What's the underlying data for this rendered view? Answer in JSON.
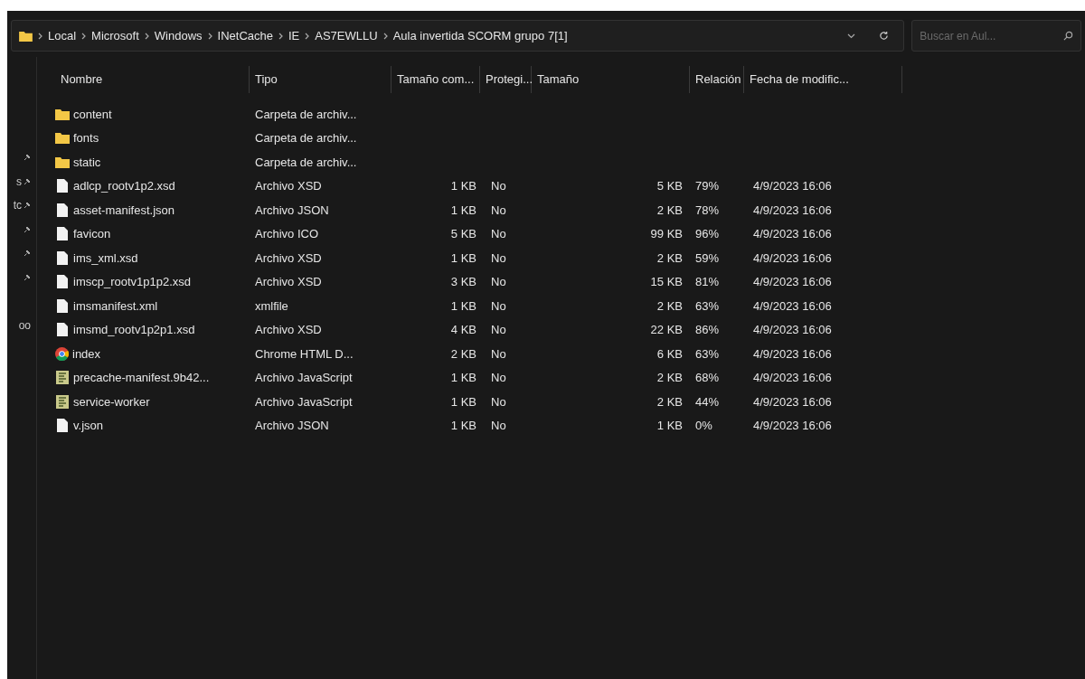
{
  "address_bar": {
    "crumbs": [
      "Local",
      "Microsoft",
      "Windows",
      "INetCache",
      "IE",
      "AS7EWLLU",
      "Aula invertida SCORM grupo 7[1]"
    ]
  },
  "search": {
    "placeholder": "Buscar en Aul..."
  },
  "sidebar": {
    "items": [
      {
        "pinned": false
      },
      {
        "pinned": false
      },
      {
        "pinned": true
      },
      {
        "label": "s",
        "pinned": true
      },
      {
        "label": "tc",
        "pinned": true
      },
      {
        "pinned": true
      },
      {
        "pinned": true
      },
      {
        "pinned": true
      },
      {
        "pinned": false
      },
      {
        "label": "oo",
        "pinned": false
      }
    ]
  },
  "table": {
    "columns": [
      "Nombre",
      "Tipo",
      "Tamaño com...",
      "Protegi...",
      "Tamaño",
      "Relación",
      "Fecha de modific..."
    ],
    "rows": [
      {
        "kind": "folder",
        "name": "content",
        "type": "Carpeta de archiv..."
      },
      {
        "kind": "folder",
        "name": "fonts",
        "type": "Carpeta de archiv..."
      },
      {
        "kind": "folder",
        "name": "static",
        "type": "Carpeta de archiv..."
      },
      {
        "kind": "file",
        "name": "adlcp_rootv1p2.xsd",
        "type": "Archivo XSD",
        "compressed": "1 KB",
        "protected": "No",
        "size": "5 KB",
        "ratio": "79%",
        "date": "4/9/2023 16:06"
      },
      {
        "kind": "file",
        "name": "asset-manifest.json",
        "type": "Archivo JSON",
        "compressed": "1 KB",
        "protected": "No",
        "size": "2 KB",
        "ratio": "78%",
        "date": "4/9/2023 16:06"
      },
      {
        "kind": "file",
        "name": "favicon",
        "type": "Archivo ICO",
        "compressed": "5 KB",
        "protected": "No",
        "size": "99 KB",
        "ratio": "96%",
        "date": "4/9/2023 16:06"
      },
      {
        "kind": "file",
        "name": "ims_xml.xsd",
        "type": "Archivo XSD",
        "compressed": "1 KB",
        "protected": "No",
        "size": "2 KB",
        "ratio": "59%",
        "date": "4/9/2023 16:06"
      },
      {
        "kind": "file",
        "name": "imscp_rootv1p1p2.xsd",
        "type": "Archivo XSD",
        "compressed": "3 KB",
        "protected": "No",
        "size": "15 KB",
        "ratio": "81%",
        "date": "4/9/2023 16:06"
      },
      {
        "kind": "file",
        "name": "imsmanifest.xml",
        "type": "xmlfile",
        "compressed": "1 KB",
        "protected": "No",
        "size": "2 KB",
        "ratio": "63%",
        "date": "4/9/2023 16:06"
      },
      {
        "kind": "file",
        "name": "imsmd_rootv1p2p1.xsd",
        "type": "Archivo XSD",
        "compressed": "4 KB",
        "protected": "No",
        "size": "22 KB",
        "ratio": "86%",
        "date": "4/9/2023 16:06"
      },
      {
        "kind": "chrome",
        "name": "index",
        "type": "Chrome HTML D...",
        "compressed": "2 KB",
        "protected": "No",
        "size": "6 KB",
        "ratio": "63%",
        "date": "4/9/2023 16:06"
      },
      {
        "kind": "script",
        "name": "precache-manifest.9b42...",
        "type": "Archivo JavaScript",
        "compressed": "1 KB",
        "protected": "No",
        "size": "2 KB",
        "ratio": "68%",
        "date": "4/9/2023 16:06"
      },
      {
        "kind": "script",
        "name": "service-worker",
        "type": "Archivo JavaScript",
        "compressed": "1 KB",
        "protected": "No",
        "size": "2 KB",
        "ratio": "44%",
        "date": "4/9/2023 16:06"
      },
      {
        "kind": "file",
        "name": "v.json",
        "type": "Archivo JSON",
        "compressed": "1 KB",
        "protected": "No",
        "size": "1 KB",
        "ratio": "0%",
        "date": "4/9/2023 16:06"
      }
    ]
  }
}
